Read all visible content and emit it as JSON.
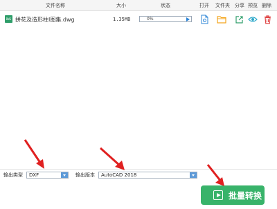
{
  "header": {
    "col_filename": "文件名称",
    "col_size": "大小",
    "col_status": "状态",
    "col_open": "打开",
    "col_folder": "文件夹",
    "col_share": "分享",
    "col_preview": "预览",
    "col_delete": "删除"
  },
  "files": [
    {
      "icon_text": "DWG",
      "name": "拼花及造形柱I图集.dwg",
      "size": "1.35MB",
      "progress_text": "0%",
      "progress_value": 0
    }
  ],
  "output": {
    "type_label": "输出类型",
    "type_value": "DXF",
    "version_label": "输出版本",
    "version_value": "AutoCAD 2018"
  },
  "convert_button": "批量转换",
  "colors": {
    "accent_green": "#38b36a",
    "folder_orange": "#f4a51c",
    "delete_red": "#e04848",
    "select_blue": "#5d9ad8",
    "annotation_red": "#e02020"
  },
  "icons": {
    "open": "file-open-icon",
    "folder": "folder-icon",
    "share": "share-icon",
    "preview": "eye-icon",
    "delete": "trash-icon"
  }
}
